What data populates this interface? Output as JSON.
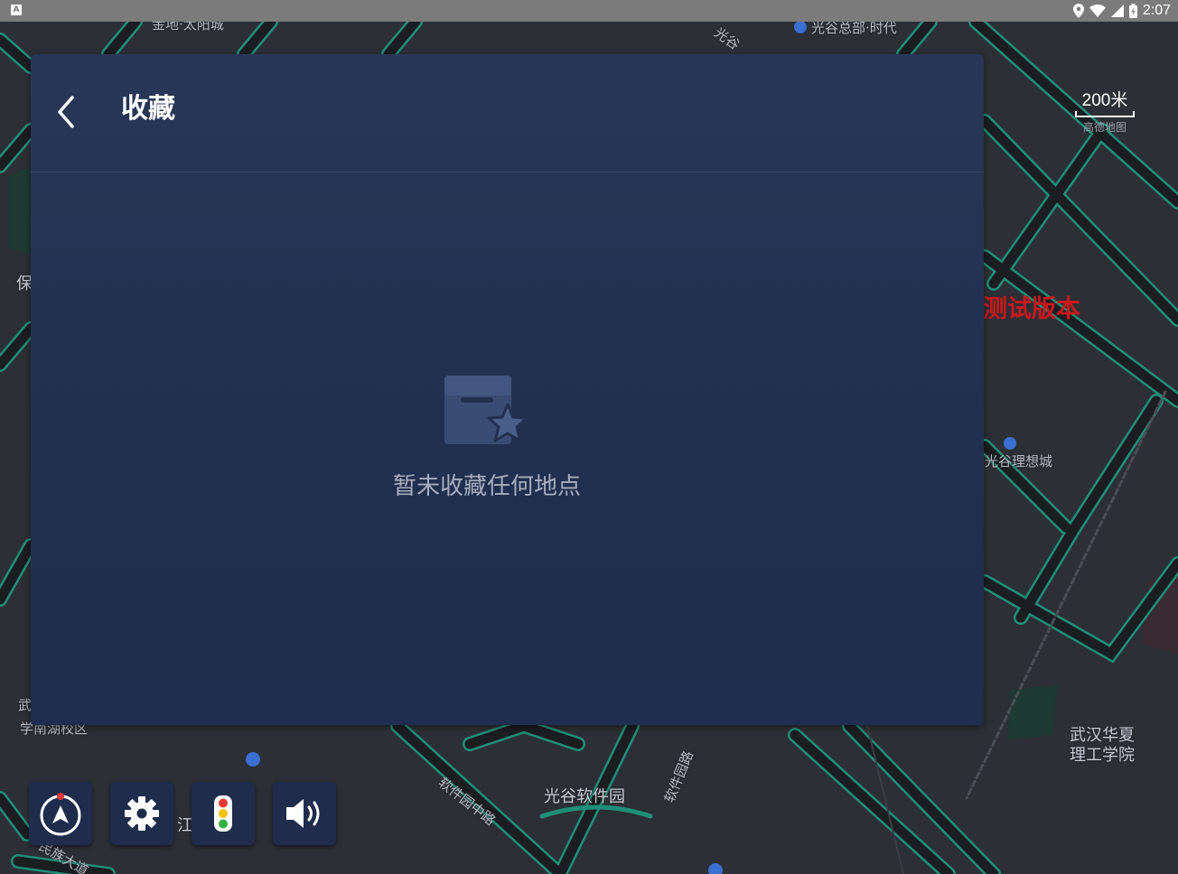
{
  "status_bar": {
    "app_icon": "A",
    "icons": [
      "location-icon",
      "wifi-icon",
      "signal-icon",
      "battery-icon"
    ],
    "time": "2:07"
  },
  "map": {
    "labels": [
      {
        "id": "l1",
        "text": "金地·太阳城"
      },
      {
        "id": "l2",
        "text": "光谷总部·时代"
      },
      {
        "id": "l3",
        "text": "光谷"
      },
      {
        "id": "l4",
        "text": "保"
      },
      {
        "id": "l5",
        "text": "光谷理想城"
      },
      {
        "id": "l6",
        "text": "武"
      },
      {
        "id": "l7",
        "text": "学南湖校区"
      },
      {
        "id": "l8",
        "text": "软件园中路"
      },
      {
        "id": "l9",
        "text": "光谷软件园"
      },
      {
        "id": "l10",
        "text": "软件园路"
      },
      {
        "id": "l11",
        "text": "武汉华夏"
      },
      {
        "id": "l12",
        "text": "理工学院"
      },
      {
        "id": "l13",
        "text": "江"
      },
      {
        "id": "l14",
        "text": "民族大道"
      }
    ],
    "watermark": "测试版本",
    "scale": {
      "value": "200米",
      "brand": "高德地图"
    }
  },
  "panel": {
    "title": "收藏",
    "back_icon": "chevron-left-icon",
    "empty_icon": "favorites-box-star-icon",
    "empty_message": "暂未收藏任何地点"
  },
  "controls": [
    {
      "name": "compass-button",
      "icon": "compass-icon"
    },
    {
      "name": "settings-button",
      "icon": "gear-icon"
    },
    {
      "name": "traffic-button",
      "icon": "traffic-light-icon"
    },
    {
      "name": "volume-button",
      "icon": "speaker-icon"
    }
  ],
  "colors": {
    "road_outline": "#1f8f77",
    "road_fill": "#1a1d22",
    "panel_bg": "#22304f",
    "control_bg": "#1f2c4c",
    "watermark": "#c8191c"
  }
}
